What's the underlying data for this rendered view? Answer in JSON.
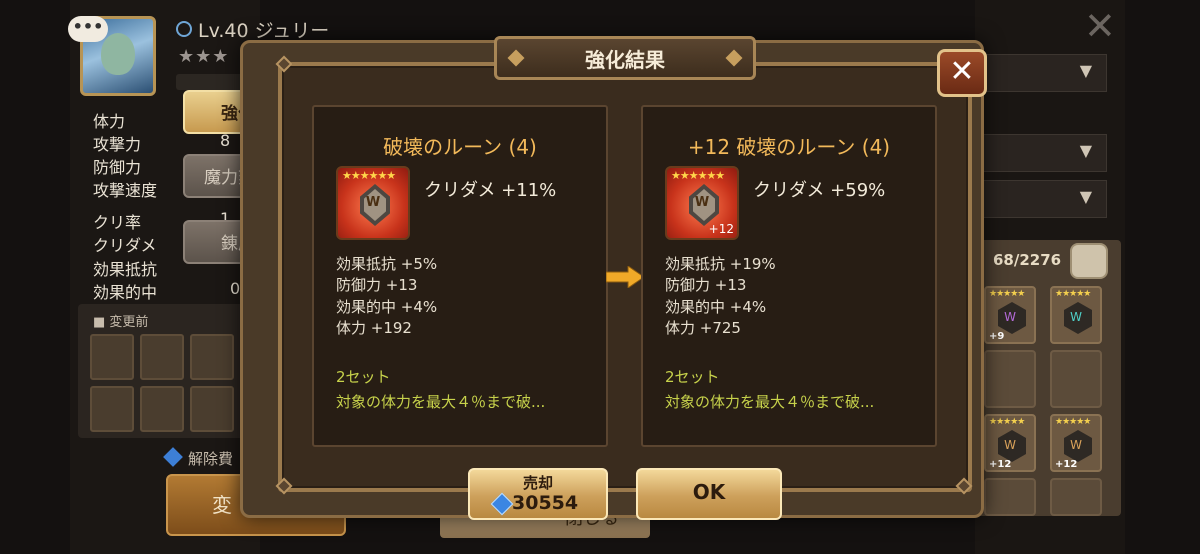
{
  "character": {
    "level_name": "Lv.40 ジュリー",
    "stars": "★★★",
    "chat": "•••",
    "stats": [
      {
        "label": "体力",
        "value": ""
      },
      {
        "label": "攻撃力",
        "value": "8"
      },
      {
        "label": "防御力",
        "value": ""
      },
      {
        "label": "攻撃速度",
        "value": ""
      },
      {
        "label": "クリ率",
        "value": "1"
      },
      {
        "label": "クリダメ",
        "value": ""
      },
      {
        "label": "効果抵抗",
        "value": ""
      },
      {
        "label": "効果的中",
        "value": "0"
      }
    ]
  },
  "tabs": [
    {
      "label": "強化",
      "active": true
    },
    {
      "label": "魔力刻印",
      "active": false
    },
    {
      "label": "錬成",
      "active": false
    }
  ],
  "before_panel": {
    "label": "■ 変更前"
  },
  "unlock_fee": {
    "label": "解除費"
  },
  "change_button": {
    "label": "変"
  },
  "inventory": {
    "count": "68/2276",
    "slots": [
      {
        "stars": "★★★★★",
        "level": "+9",
        "glyph_color": "#b46ad8"
      },
      {
        "stars": "★★★★★",
        "level": "",
        "glyph_color": "#4fd0c8"
      },
      {
        "stars": "",
        "level": "",
        "glyph_color": ""
      },
      {
        "stars": "",
        "level": "",
        "glyph_color": ""
      },
      {
        "stars": "★★★★★",
        "level": "+12",
        "glyph_color": "#d9a25a"
      },
      {
        "stars": "★★★★★",
        "level": "+12",
        "glyph_color": "#d9a25a"
      },
      {
        "stars": "",
        "level": "",
        "glyph_color": ""
      },
      {
        "stars": "",
        "level": "",
        "glyph_color": ""
      }
    ]
  },
  "modal": {
    "title": "強化結果",
    "close_symbol": "✕",
    "before": {
      "title": "破壊のルーン (4)",
      "rune_stars": "★★★★★★",
      "rune_level": "",
      "main_stat": "クリダメ +11%",
      "substats": [
        "効果抵抗 +5%",
        "防御力 +13",
        "効果的中 +4%",
        "体力 +192"
      ],
      "set_label": "2セット",
      "set_desc": "対象の体力を最大４％まで破..."
    },
    "after": {
      "title": "+12 破壊のルーン (4)",
      "rune_stars": "★★★★★★",
      "rune_level": "+12",
      "main_stat": "クリダメ +59%",
      "substats": [
        "効果抵抗 +19%",
        "防御力 +13",
        "効果的中 +4%",
        "体力 +725"
      ],
      "set_label": "2セット",
      "set_desc": "対象の体力を最大４％まで破..."
    },
    "sell_button": {
      "label": "売却",
      "price": "30554"
    },
    "ok_button": {
      "label": "OK"
    },
    "behind_button": {
      "label": "閉じる"
    }
  },
  "colors": {
    "accent_gold": "#f2b95a",
    "set_text": "#c7d24b",
    "crystal_blue": "#3b86e2"
  }
}
